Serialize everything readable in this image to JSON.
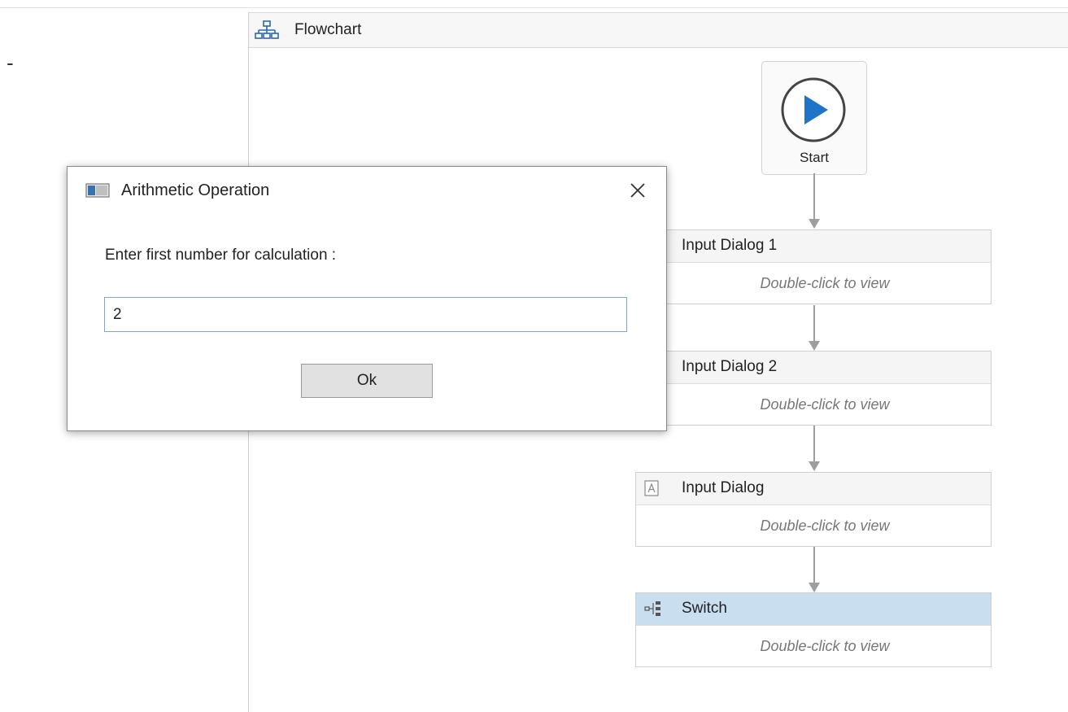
{
  "decoration": {
    "dash": "-"
  },
  "designer": {
    "title": "Flowchart",
    "icon": "flowchart-icon"
  },
  "start": {
    "label": "Start",
    "icon": "play-circle-icon",
    "accent": "#1e74c6"
  },
  "activities": [
    {
      "title": "Input Dialog 1",
      "hint": "Double-click to view"
    },
    {
      "title": "Input Dialog 2",
      "hint": "Double-click to view"
    },
    {
      "title": "Input Dialog",
      "hint": "Double-click to view",
      "icon": "input-dialog-icon"
    },
    {
      "title": "Switch",
      "hint": "Double-click to view",
      "icon": "switch-icon",
      "selected": true
    }
  ],
  "dialog": {
    "title": "Arithmetic Operation",
    "prompt": "Enter first number for calculation :",
    "input_value": "2",
    "ok_label": "Ok",
    "icon": "window-icon"
  },
  "colors": {
    "selected_header": "#c9dff0",
    "connector": "#9e9e9e",
    "input_border": "#7aa7d4"
  }
}
